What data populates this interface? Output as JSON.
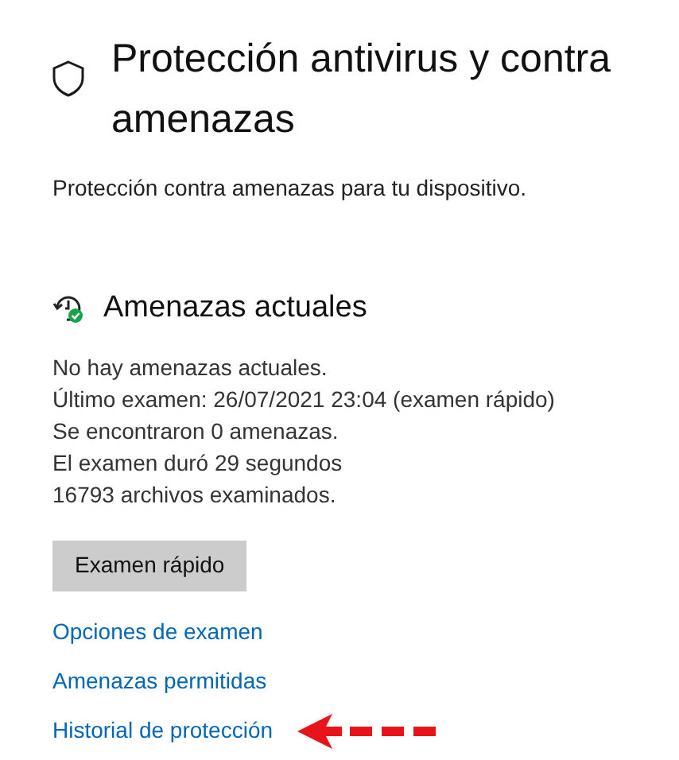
{
  "header": {
    "title": "Protección antivirus y contra amenazas",
    "subtitle": "Protección contra amenazas para tu dispositivo."
  },
  "section": {
    "title": "Amenazas actuales",
    "lines": [
      "No hay amenazas actuales.",
      "Último examen: 26/07/2021 23:04 (examen rápido)",
      "Se encontraron 0 amenazas.",
      "El examen duró 29 segundos",
      "16793 archivos examinados."
    ],
    "button": "Examen rápido"
  },
  "links": [
    {
      "label": "Opciones de examen",
      "highlighted": false
    },
    {
      "label": "Amenazas permitidas",
      "highlighted": false
    },
    {
      "label": "Historial de protección",
      "highlighted": true
    }
  ]
}
